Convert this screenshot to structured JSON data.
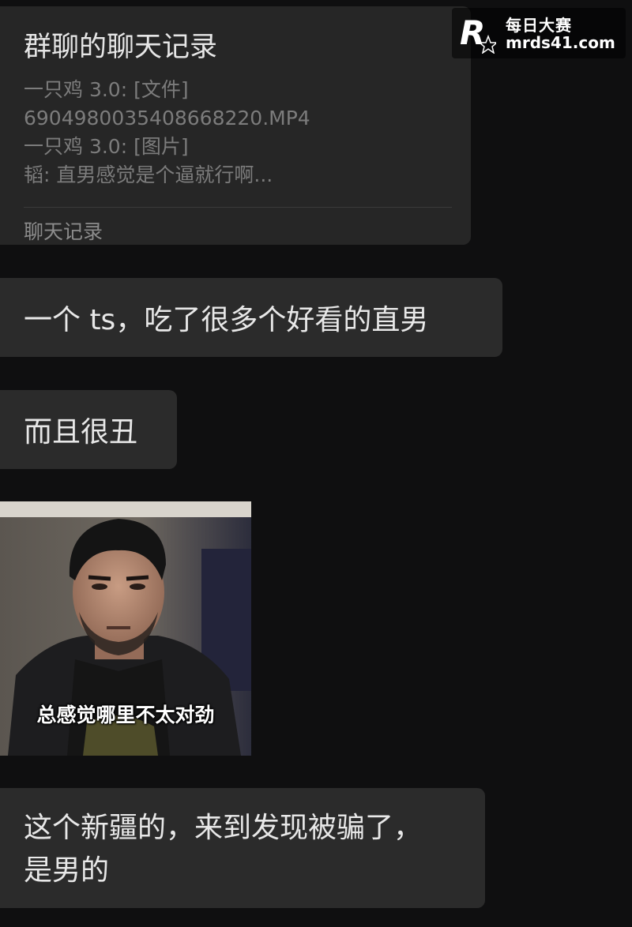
{
  "watermark": {
    "name": "每日大赛",
    "site": "mrds41.com",
    "logo_letter": "R"
  },
  "chat_record": {
    "title": "群聊的聊天记录",
    "lines": [
      "一只鸡 3.0: [文件]",
      "69049800354086682​20.MP4",
      "一只鸡 3.0: [图片]",
      "韬: 直男感觉是个逼就行啊..."
    ],
    "footer": "聊天记录"
  },
  "messages": [
    {
      "text": "一个 ts，吃了很多个好看的直男"
    },
    {
      "text": "而且很丑"
    },
    {
      "text": "这个新疆的，来到发现被骗了，\n是男的"
    }
  ],
  "meme": {
    "caption": "总感觉哪里不太对劲",
    "icon": "man-portrait-photo"
  },
  "colors": {
    "background": "#0f0f10",
    "bubble": "#2b2b2b",
    "card": "#262626",
    "muted_text": "#7c7c7c"
  }
}
